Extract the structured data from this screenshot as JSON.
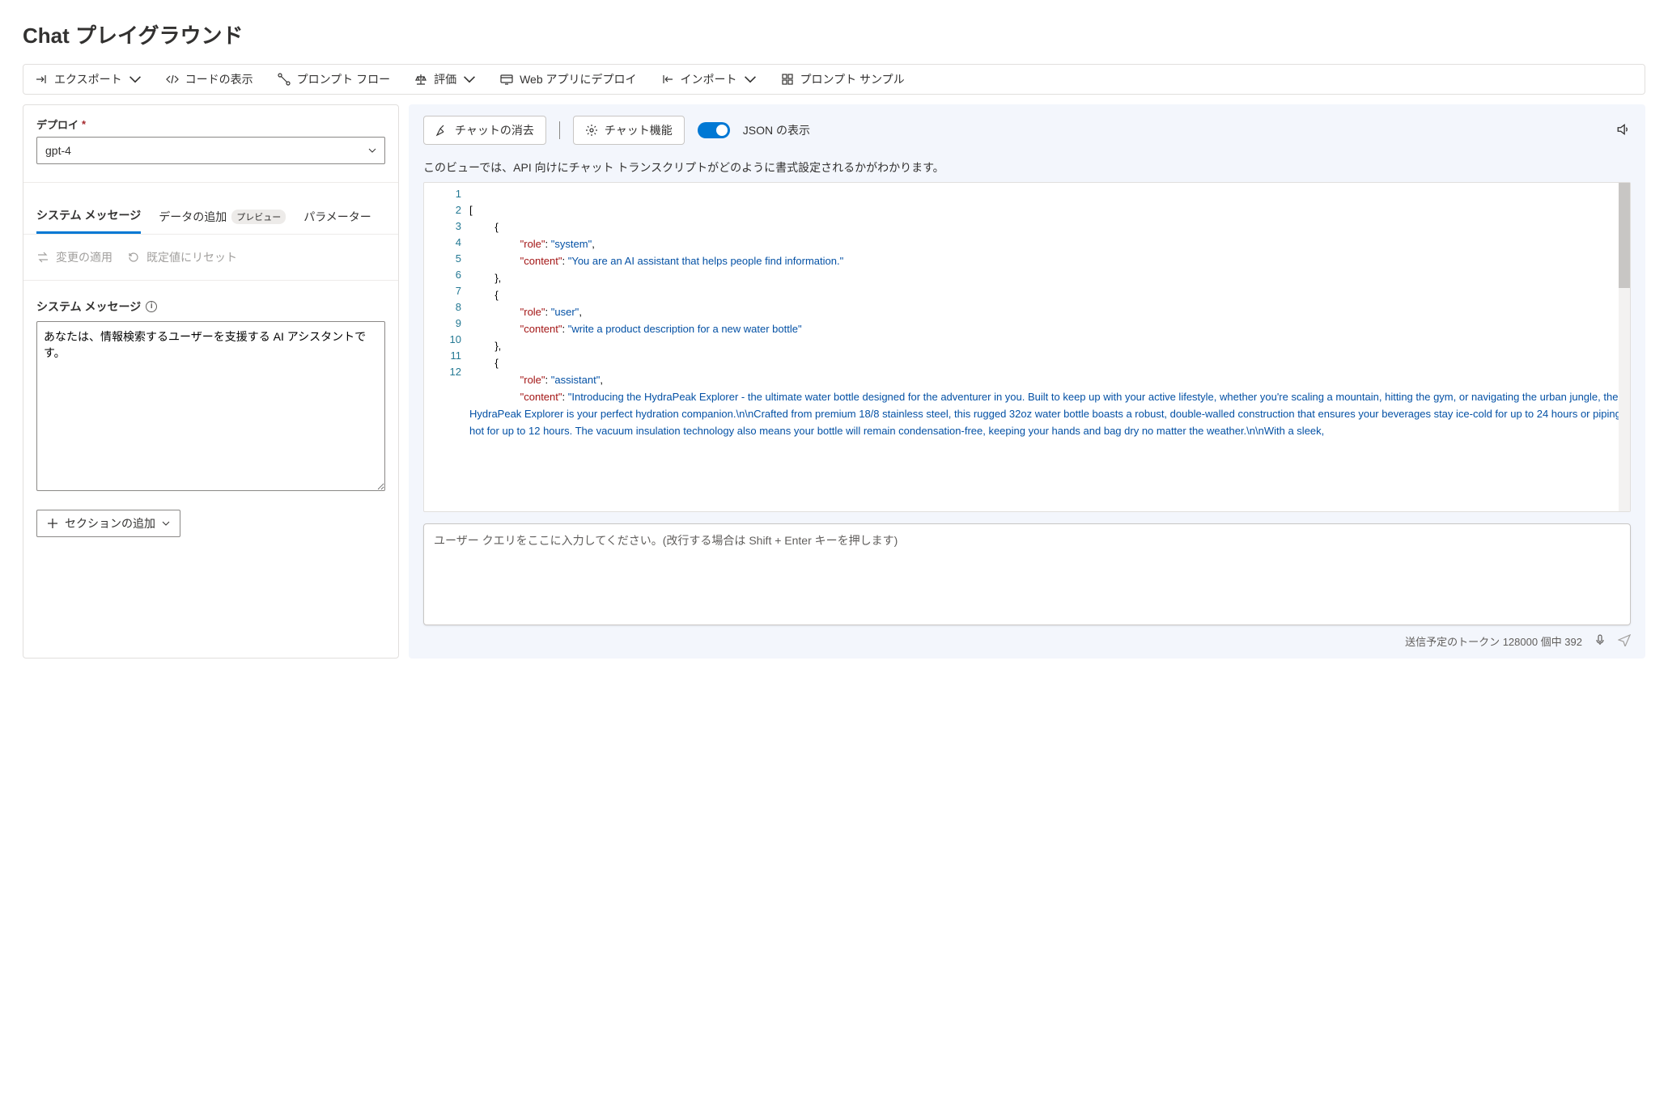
{
  "page_title": "Chat プレイグラウンド",
  "toolbar": {
    "export": "エクスポート",
    "show_code": "コードの表示",
    "prompt_flow": "プロンプト フロー",
    "evaluate": "評価",
    "deploy_web": "Web アプリにデプロイ",
    "import": "インポート",
    "prompt_samples": "プロンプト サンプル"
  },
  "left": {
    "deploy_label": "デプロイ",
    "deploy_value": "gpt-4",
    "tabs": {
      "system_message": "システム メッセージ",
      "add_data": "データの追加",
      "add_data_badge": "プレビュー",
      "parameters": "パラメーター"
    },
    "apply_changes": "変更の適用",
    "reset_default": "既定値にリセット",
    "sys_msg_label": "システム メッセージ",
    "sys_msg_value": "あなたは、情報検索するユーザーを支援する AI アシスタントです。",
    "add_section": "セクションの追加"
  },
  "right": {
    "clear_chat": "チャットの消去",
    "chat_features": "チャット機能",
    "json_view": "JSON の表示",
    "desc": "このビューでは、API 向けにチャット トランスクリプトがどのように書式設定されるかがわかります。",
    "gutter": [
      "1",
      "2",
      "3",
      "4",
      "5",
      "6",
      "7",
      "8",
      "9",
      "10",
      "11",
      "12"
    ],
    "code": {
      "l1": "[",
      "l2": "{",
      "l3a": "\"role\"",
      "l3b": ": ",
      "l3c": "\"system\"",
      "l3d": ",",
      "l4a": "\"content\"",
      "l4b": ": ",
      "l4c": "\"You are an AI assistant that helps people find information.\"",
      "l5": "},",
      "l6": "{",
      "l7a": "\"role\"",
      "l7b": ": ",
      "l7c": "\"user\"",
      "l7d": ",",
      "l8a": "\"content\"",
      "l8b": ": ",
      "l8c": "\"write a product description for a new water bottle\"",
      "l9": "},",
      "l10": "{",
      "l11a": "\"role\"",
      "l11b": ": ",
      "l11c": "\"assistant\"",
      "l11d": ",",
      "l12a": "\"content\"",
      "l12b": ": ",
      "l12c": "\"Introducing the HydraPeak Explorer - the ultimate water bottle designed for the adventurer in you. Built to keep up with your active lifestyle, whether you're scaling a mountain, hitting the gym, or navigating the urban jungle, the HydraPeak Explorer is your perfect hydration companion.\\n\\nCrafted from premium 18/8 stainless steel, this rugged 32oz water bottle boasts a robust, double-walled construction that ensures your beverages stay ice-cold for up to 24 hours or piping hot for up to 12 hours. The vacuum insulation technology also means your bottle will remain condensation-free, keeping your hands and bag dry no matter the weather.\\n\\nWith a sleek,"
    },
    "query_placeholder": "ユーザー クエリをここに入力してください。(改行する場合は Shift + Enter キーを押します)",
    "footer_tokens": "送信予定のトークン 128000 個中 392"
  }
}
